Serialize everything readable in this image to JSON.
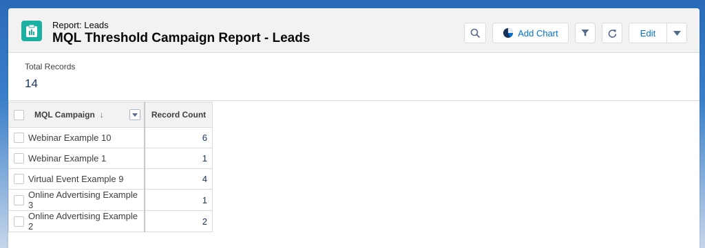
{
  "header": {
    "subtitle": "Report: Leads",
    "title": "MQL Threshold Campaign Report - Leads",
    "icon": "report-icon",
    "buttons": {
      "add_chart_label": "Add Chart",
      "edit_label": "Edit"
    }
  },
  "summary": {
    "total_label": "Total Records",
    "total_value": "14"
  },
  "table": {
    "columns": [
      "MQL Campaign",
      "Record Count"
    ],
    "rows": [
      {
        "campaign": "Webinar Example 10",
        "count": "6"
      },
      {
        "campaign": "Webinar Example 1",
        "count": "1"
      },
      {
        "campaign": "Virtual Event Example 9",
        "count": "4"
      },
      {
        "campaign": "Online Advertising Example 3",
        "count": "1"
      },
      {
        "campaign": "Online Advertising Example 2",
        "count": "2"
      }
    ]
  },
  "colors": {
    "brand_icon": "#1ab1a3",
    "accent": "#0070d2",
    "value_text": "#16325c"
  }
}
